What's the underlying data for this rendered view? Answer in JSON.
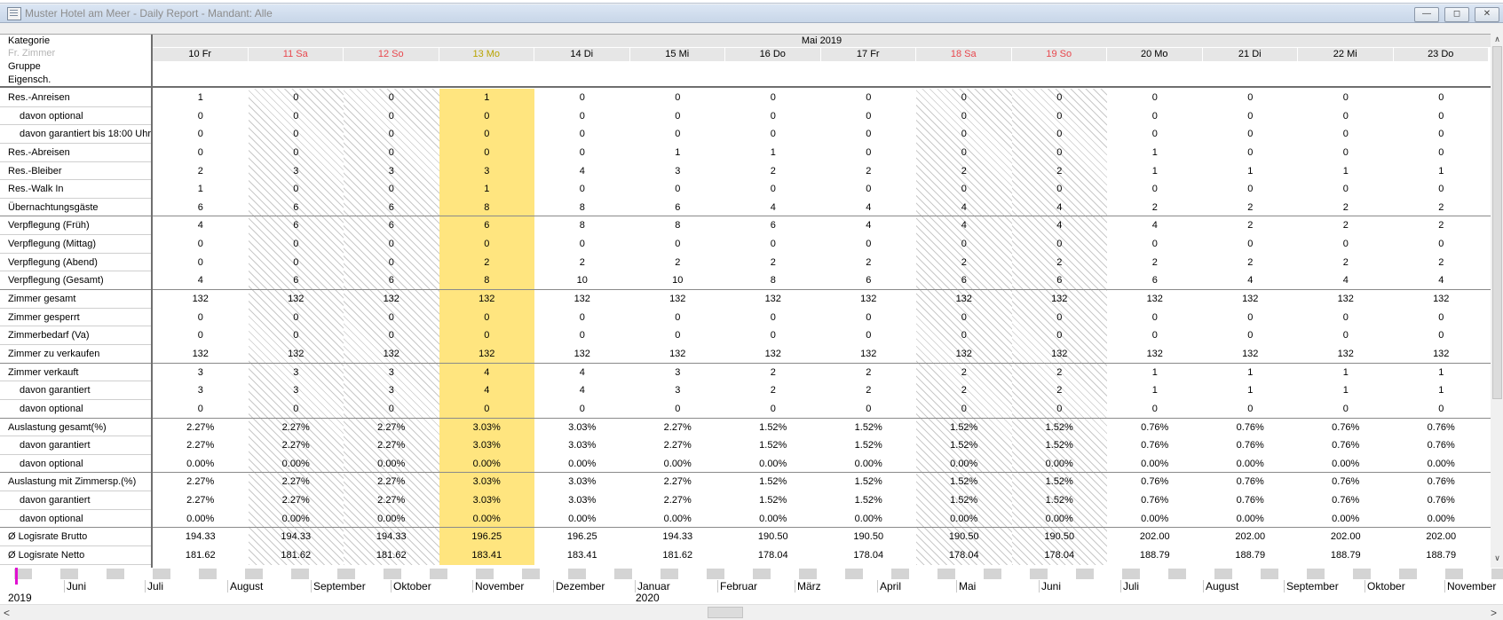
{
  "window": {
    "title": "Muster Hotel am Meer - Daily Report - Mandant: Alle",
    "min_icon": "minimize-icon",
    "max_icon": "maximize-icon",
    "close_icon": "close-icon"
  },
  "header": {
    "labels": [
      "Kategorie",
      "Fr. Zimmer",
      "Gruppe",
      "Eigensch."
    ],
    "month": "Mai 2019"
  },
  "days": [
    {
      "label": "10 Fr",
      "weekend": false,
      "today": false
    },
    {
      "label": "11 Sa",
      "weekend": true,
      "today": false
    },
    {
      "label": "12 So",
      "weekend": true,
      "today": false
    },
    {
      "label": "13 Mo",
      "weekend": false,
      "today": true
    },
    {
      "label": "14 Di",
      "weekend": false,
      "today": false
    },
    {
      "label": "15 Mi",
      "weekend": false,
      "today": false
    },
    {
      "label": "16 Do",
      "weekend": false,
      "today": false
    },
    {
      "label": "17 Fr",
      "weekend": false,
      "today": false
    },
    {
      "label": "18 Sa",
      "weekend": true,
      "today": false
    },
    {
      "label": "19 So",
      "weekend": true,
      "today": false
    },
    {
      "label": "20 Mo",
      "weekend": false,
      "today": false
    },
    {
      "label": "21 Di",
      "weekend": false,
      "today": false
    },
    {
      "label": "22 Mi",
      "weekend": false,
      "today": false
    },
    {
      "label": "23 Do",
      "weekend": false,
      "today": false
    }
  ],
  "rows": [
    {
      "label": "Res.-Anreisen",
      "sub": false,
      "values": [
        "1",
        "0",
        "0",
        "1",
        "0",
        "0",
        "0",
        "0",
        "0",
        "0",
        "0",
        "0",
        "0",
        "0"
      ]
    },
    {
      "label": "davon optional",
      "sub": true,
      "values": [
        "0",
        "0",
        "0",
        "0",
        "0",
        "0",
        "0",
        "0",
        "0",
        "0",
        "0",
        "0",
        "0",
        "0"
      ]
    },
    {
      "label": "davon garantiert bis 18:00 Uhr",
      "sub": true,
      "values": [
        "0",
        "0",
        "0",
        "0",
        "0",
        "0",
        "0",
        "0",
        "0",
        "0",
        "0",
        "0",
        "0",
        "0"
      ]
    },
    {
      "label": "Res.-Abreisen",
      "sub": false,
      "values": [
        "0",
        "0",
        "0",
        "0",
        "0",
        "1",
        "1",
        "0",
        "0",
        "0",
        "1",
        "0",
        "0",
        "0"
      ]
    },
    {
      "label": "Res.-Bleiber",
      "sub": false,
      "values": [
        "2",
        "3",
        "3",
        "3",
        "4",
        "3",
        "2",
        "2",
        "2",
        "2",
        "1",
        "1",
        "1",
        "1"
      ]
    },
    {
      "label": "Res.-Walk In",
      "sub": false,
      "values": [
        "1",
        "0",
        "0",
        "1",
        "0",
        "0",
        "0",
        "0",
        "0",
        "0",
        "0",
        "0",
        "0",
        "0"
      ]
    },
    {
      "label": "Übernachtungsgäste",
      "sub": false,
      "values": [
        "6",
        "6",
        "6",
        "8",
        "8",
        "6",
        "4",
        "4",
        "4",
        "4",
        "2",
        "2",
        "2",
        "2"
      ]
    },
    {
      "label": "Verpflegung (Früh)",
      "sub": false,
      "values": [
        "4",
        "6",
        "6",
        "6",
        "8",
        "8",
        "6",
        "4",
        "4",
        "4",
        "4",
        "2",
        "2",
        "2"
      ]
    },
    {
      "label": "Verpflegung (Mittag)",
      "sub": false,
      "values": [
        "0",
        "0",
        "0",
        "0",
        "0",
        "0",
        "0",
        "0",
        "0",
        "0",
        "0",
        "0",
        "0",
        "0"
      ]
    },
    {
      "label": "Verpflegung (Abend)",
      "sub": false,
      "values": [
        "0",
        "0",
        "0",
        "2",
        "2",
        "2",
        "2",
        "2",
        "2",
        "2",
        "2",
        "2",
        "2",
        "2"
      ]
    },
    {
      "label": "Verpflegung (Gesamt)",
      "sub": false,
      "values": [
        "4",
        "6",
        "6",
        "8",
        "10",
        "10",
        "8",
        "6",
        "6",
        "6",
        "6",
        "4",
        "4",
        "4"
      ]
    },
    {
      "label": "Zimmer gesamt",
      "sub": false,
      "values": [
        "132",
        "132",
        "132",
        "132",
        "132",
        "132",
        "132",
        "132",
        "132",
        "132",
        "132",
        "132",
        "132",
        "132"
      ]
    },
    {
      "label": "Zimmer gesperrt",
      "sub": false,
      "values": [
        "0",
        "0",
        "0",
        "0",
        "0",
        "0",
        "0",
        "0",
        "0",
        "0",
        "0",
        "0",
        "0",
        "0"
      ]
    },
    {
      "label": "Zimmerbedarf (Va)",
      "sub": false,
      "values": [
        "0",
        "0",
        "0",
        "0",
        "0",
        "0",
        "0",
        "0",
        "0",
        "0",
        "0",
        "0",
        "0",
        "0"
      ]
    },
    {
      "label": "Zimmer zu verkaufen",
      "sub": false,
      "values": [
        "132",
        "132",
        "132",
        "132",
        "132",
        "132",
        "132",
        "132",
        "132",
        "132",
        "132",
        "132",
        "132",
        "132"
      ]
    },
    {
      "label": "Zimmer verkauft",
      "sub": false,
      "values": [
        "3",
        "3",
        "3",
        "4",
        "4",
        "3",
        "2",
        "2",
        "2",
        "2",
        "1",
        "1",
        "1",
        "1"
      ]
    },
    {
      "label": "davon garantiert",
      "sub": true,
      "values": [
        "3",
        "3",
        "3",
        "4",
        "4",
        "3",
        "2",
        "2",
        "2",
        "2",
        "1",
        "1",
        "1",
        "1"
      ]
    },
    {
      "label": "davon optional",
      "sub": true,
      "values": [
        "0",
        "0",
        "0",
        "0",
        "0",
        "0",
        "0",
        "0",
        "0",
        "0",
        "0",
        "0",
        "0",
        "0"
      ]
    },
    {
      "label": "Auslastung gesamt(%)",
      "sub": false,
      "values": [
        "2.27%",
        "2.27%",
        "2.27%",
        "3.03%",
        "3.03%",
        "2.27%",
        "1.52%",
        "1.52%",
        "1.52%",
        "1.52%",
        "0.76%",
        "0.76%",
        "0.76%",
        "0.76%"
      ]
    },
    {
      "label": "davon garantiert",
      "sub": true,
      "values": [
        "2.27%",
        "2.27%",
        "2.27%",
        "3.03%",
        "3.03%",
        "2.27%",
        "1.52%",
        "1.52%",
        "1.52%",
        "1.52%",
        "0.76%",
        "0.76%",
        "0.76%",
        "0.76%"
      ]
    },
    {
      "label": "davon optional",
      "sub": true,
      "values": [
        "0.00%",
        "0.00%",
        "0.00%",
        "0.00%",
        "0.00%",
        "0.00%",
        "0.00%",
        "0.00%",
        "0.00%",
        "0.00%",
        "0.00%",
        "0.00%",
        "0.00%",
        "0.00%"
      ]
    },
    {
      "label": "Auslastung mit Zimmersp.(%)",
      "sub": false,
      "values": [
        "2.27%",
        "2.27%",
        "2.27%",
        "3.03%",
        "3.03%",
        "2.27%",
        "1.52%",
        "1.52%",
        "1.52%",
        "1.52%",
        "0.76%",
        "0.76%",
        "0.76%",
        "0.76%"
      ]
    },
    {
      "label": "davon garantiert",
      "sub": true,
      "values": [
        "2.27%",
        "2.27%",
        "2.27%",
        "3.03%",
        "3.03%",
        "2.27%",
        "1.52%",
        "1.52%",
        "1.52%",
        "1.52%",
        "0.76%",
        "0.76%",
        "0.76%",
        "0.76%"
      ]
    },
    {
      "label": "davon optional",
      "sub": true,
      "values": [
        "0.00%",
        "0.00%",
        "0.00%",
        "0.00%",
        "0.00%",
        "0.00%",
        "0.00%",
        "0.00%",
        "0.00%",
        "0.00%",
        "0.00%",
        "0.00%",
        "0.00%",
        "0.00%"
      ]
    },
    {
      "label": "Ø Logisrate Brutto",
      "sub": false,
      "values": [
        "194.33",
        "194.33",
        "194.33",
        "196.25",
        "196.25",
        "194.33",
        "190.50",
        "190.50",
        "190.50",
        "190.50",
        "202.00",
        "202.00",
        "202.00",
        "202.00"
      ]
    },
    {
      "label": "Ø Logisrate Netto",
      "sub": false,
      "values": [
        "181.62",
        "181.62",
        "181.62",
        "183.41",
        "183.41",
        "181.62",
        "178.04",
        "178.04",
        "178.04",
        "178.04",
        "188.79",
        "188.79",
        "188.79",
        "188.79"
      ]
    }
  ],
  "timeline": {
    "months": [
      "Juni",
      "Juli",
      "August",
      "September",
      "Oktober",
      "November",
      "Dezember",
      "Januar",
      "Februar",
      "März",
      "April",
      "Mai",
      "Juni",
      "Juli",
      "August",
      "September",
      "Oktober",
      "November"
    ],
    "years": [
      "2019",
      "2020"
    ]
  },
  "colors": {
    "weekend_text": "#e8474d",
    "today_text": "#b8a400",
    "today_bg": "#ffe57f",
    "marker": "#e010d0"
  }
}
